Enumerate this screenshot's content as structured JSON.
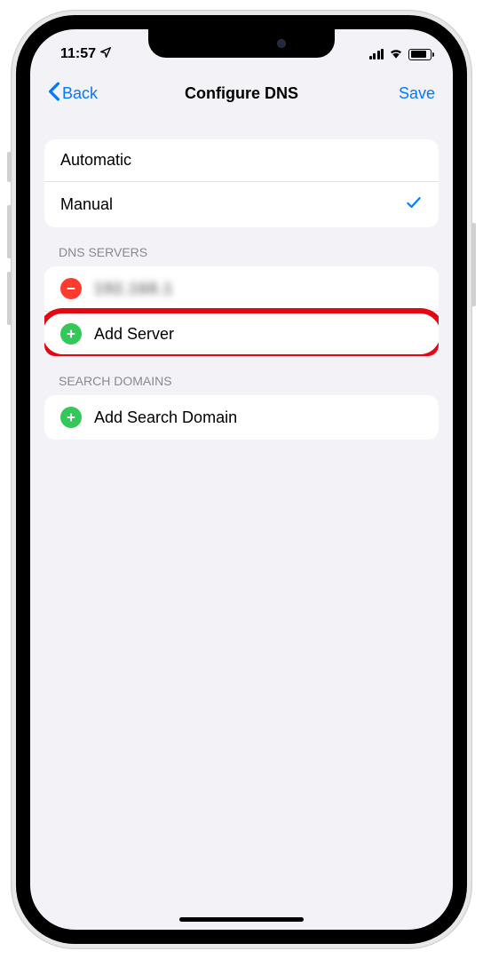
{
  "status": {
    "time": "11:57",
    "location_icon": "location-arrow-icon"
  },
  "nav": {
    "back_label": "Back",
    "title": "Configure DNS",
    "save_label": "Save"
  },
  "mode": {
    "automatic_label": "Automatic",
    "manual_label": "Manual",
    "selected": "manual"
  },
  "dns_servers": {
    "header": "DNS SERVERS",
    "server_obscured": "192.168.1",
    "add_label": "Add Server"
  },
  "search_domains": {
    "header": "SEARCH DOMAINS",
    "add_label": "Add Search Domain"
  }
}
